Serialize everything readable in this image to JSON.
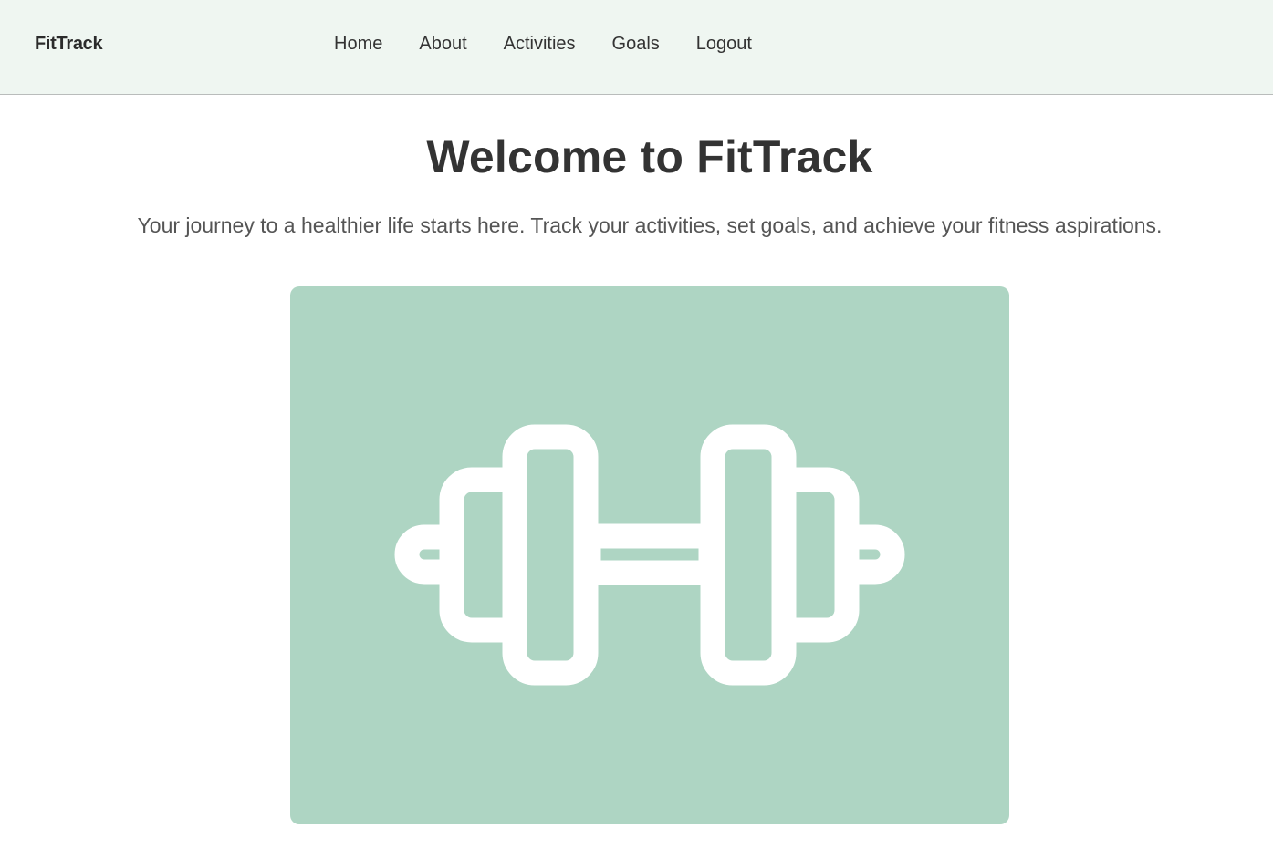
{
  "header": {
    "brand": "FitTrack",
    "nav": [
      {
        "label": "Home"
      },
      {
        "label": "About"
      },
      {
        "label": "Activities"
      },
      {
        "label": "Goals"
      },
      {
        "label": "Logout"
      }
    ]
  },
  "main": {
    "title": "Welcome to FitTrack",
    "tagline": "Your journey to a healthier life starts here. Track your activities, set goals, and achieve your fitness aspirations.",
    "hero_icon": "dumbbell-icon"
  },
  "colors": {
    "header_bg": "#eff6f1",
    "hero_bg": "#aed5c3",
    "icon": "#ffffff",
    "text": "#333333"
  }
}
